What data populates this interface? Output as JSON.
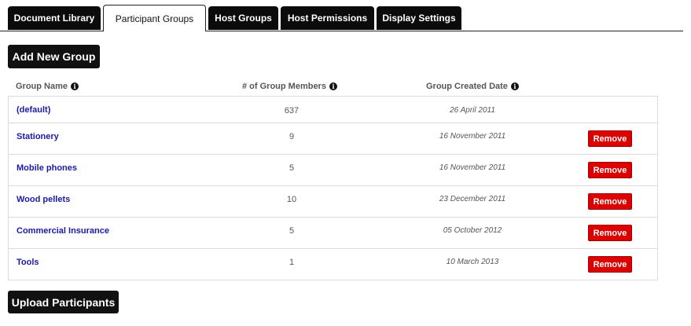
{
  "tabs": [
    {
      "label": "Document Library",
      "active": false
    },
    {
      "label": "Participant Groups",
      "active": true
    },
    {
      "label": "Host Groups",
      "active": false
    },
    {
      "label": "Host Permissions",
      "active": false
    },
    {
      "label": "Display Settings",
      "active": false
    }
  ],
  "add_group_button": "Add New Group",
  "columns": {
    "name": "Group Name",
    "members": "# of Group Members",
    "created": "Group Created Date"
  },
  "info_icon": "info-icon",
  "groups": [
    {
      "name": "(default)",
      "members": "637",
      "created": "26 April 2011",
      "removable": false
    },
    {
      "name": "Stationery",
      "members": "9",
      "created": "16 November 2011",
      "removable": true
    },
    {
      "name": "Mobile phones",
      "members": "5",
      "created": "16 November 2011",
      "removable": true
    },
    {
      "name": "Wood pellets",
      "members": "10",
      "created": "23 December 2011",
      "removable": true
    },
    {
      "name": "Commercial Insurance",
      "members": "5",
      "created": "05 October 2012",
      "removable": true
    },
    {
      "name": "Tools",
      "members": "1",
      "created": "10 March 2013",
      "removable": true
    }
  ],
  "remove_label": "Remove",
  "upload_button": "Upload Participants",
  "colors": {
    "remove": "#dd0000",
    "link": "#1a1aa6",
    "dark": "#111111"
  }
}
